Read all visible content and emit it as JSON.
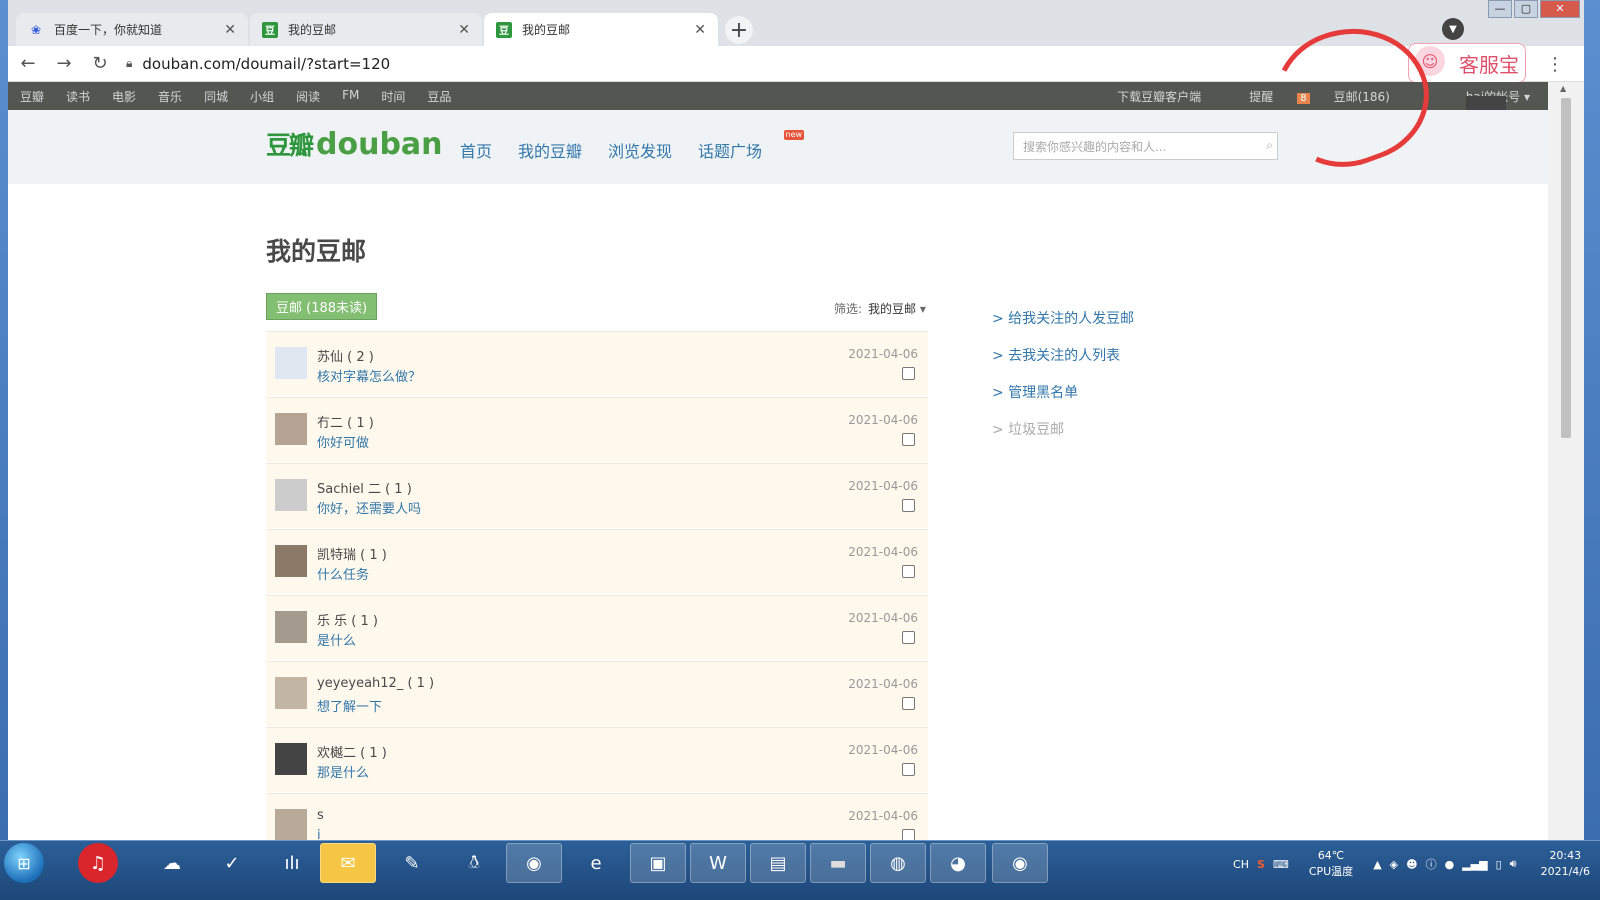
{
  "browser": {
    "tabs": [
      {
        "title": "百度一下，你就知道",
        "active": false,
        "icon": "baidu-paw-icon"
      },
      {
        "title": "我的豆邮",
        "active": false,
        "icon": "douban-icon"
      },
      {
        "title": "我的豆邮",
        "active": true,
        "icon": "douban-icon"
      }
    ],
    "url": "douban.com/doumail/?start=120",
    "extension_label": "客服宝"
  },
  "douban": {
    "global_nav": [
      "豆瓣",
      "读书",
      "电影",
      "音乐",
      "同城",
      "小组",
      "阅读",
      "FM",
      "时间",
      "豆品"
    ],
    "download": "下载豆瓣客户端",
    "reminder": "提醒",
    "reminder_count": "8",
    "doumail": "豆邮(186)",
    "account": "hai的帐号",
    "logo_cn": "豆瓣",
    "logo_en": "douban",
    "main_nav": [
      "首页",
      "我的豆瓣",
      "浏览发现",
      "话题广场"
    ],
    "new_badge": "new",
    "search_placeholder": "搜索你感兴趣的内容和人..."
  },
  "page": {
    "title": "我的豆邮",
    "tab_label": "豆邮 (188未读)",
    "filter_label": "筛选:",
    "filter_value": "我的豆邮"
  },
  "messages": [
    {
      "name": "苏仙 ( 2 )",
      "msg": "核对字幕怎么做？",
      "date": "2021-04-06",
      "avatar_color": "#dfe8f0"
    },
    {
      "name": "冇二 ( 1 )",
      "msg": "你好可做",
      "date": "2021-04-06",
      "avatar_color": "#b7a394"
    },
    {
      "name": "Sachiel ⼆ ( 1 )",
      "msg": "你好，还需要人吗",
      "date": "2021-04-06",
      "avatar_color": "#ccc"
    },
    {
      "name": "凯特瑞 ( 1 )",
      "msg": "什么任务",
      "date": "2021-04-06",
      "avatar_color": "#8b7a68"
    },
    {
      "name": "乐 乐 ( 1 )",
      "msg": "是什么",
      "date": "2021-04-06",
      "avatar_color": "#a59a8e"
    },
    {
      "name": "yeyeyeah12_ ( 1 )",
      "msg": "想了解一下",
      "date": "2021-04-06",
      "avatar_color": "#c2b5a4"
    },
    {
      "name": "欢樾⼆ ( 1 )",
      "msg": "那是什么",
      "date": "2021-04-06",
      "avatar_color": "#444"
    },
    {
      "name": "s",
      "msg": "i",
      "date": "2021-04-06",
      "avatar_color": "#b9a999"
    }
  ],
  "sidebar": {
    "links": [
      "> 给我关注的人发豆邮",
      "> 去我关注的人列表",
      "> 管理黑名单"
    ],
    "trash": "> 垃圾豆邮"
  },
  "taskbar": {
    "tray_lang": "CH",
    "temp_value": "64℃",
    "temp_label": "CPU温度",
    "time": "20:43",
    "date": "2021/4/6"
  }
}
